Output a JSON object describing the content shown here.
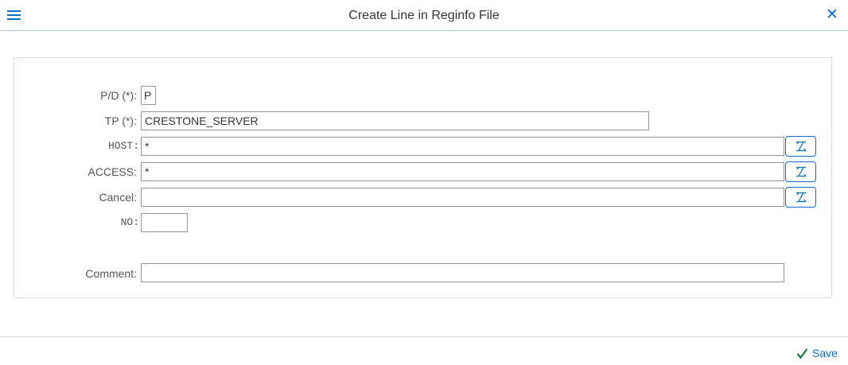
{
  "dialog": {
    "title": "Create Line in Reginfo File",
    "menu_icon": "hamburger-menu-icon",
    "close_icon": "close-icon"
  },
  "form": {
    "pd": {
      "label": "P/D (*):",
      "value": "P"
    },
    "tp": {
      "label": "TP (*):",
      "value": "CRESTONE_SERVER"
    },
    "host": {
      "label": "HOST:",
      "value": "*",
      "help_icon": "value-help-icon"
    },
    "access": {
      "label": "ACCESS:",
      "value": "*",
      "help_icon": "value-help-icon"
    },
    "cancel": {
      "label": "Cancel:",
      "value": "",
      "help_icon": "value-help-icon"
    },
    "no": {
      "label": "NO:",
      "value": ""
    },
    "comment": {
      "label": "Comment:",
      "value": ""
    }
  },
  "footer": {
    "save_label": "Save",
    "save_icon": "checkmark-icon"
  },
  "colors": {
    "accent": "#0a6ed1",
    "save_check": "#107e3e"
  }
}
